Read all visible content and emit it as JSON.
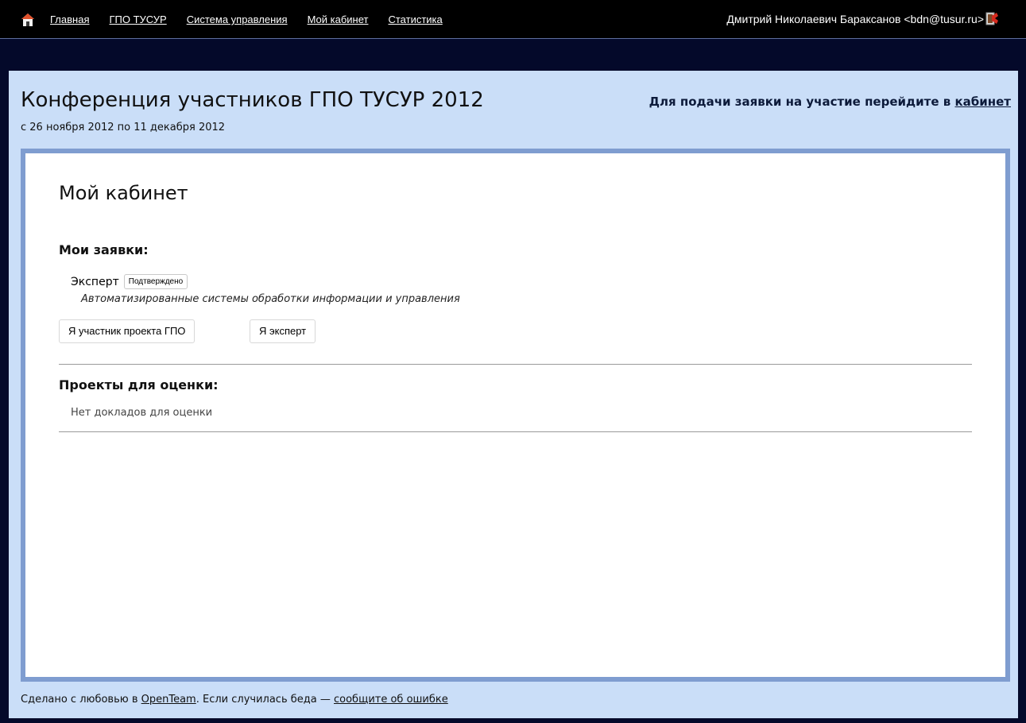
{
  "nav": {
    "links": [
      "Главная",
      "ГПО ТУСУР",
      "Система управления",
      "Мой кабинет",
      "Статистика"
    ],
    "user": "Дмитрий Николаевич Бараксанов <bdn@tusur.ru>"
  },
  "header": {
    "title": "Конференция участников ГПО ТУСУР 2012",
    "dates": "с 26 ноября 2012 по 11 декабря 2012",
    "apply_text": "Для подачи заявки на участие перейдите в",
    "apply_link": "кабинет"
  },
  "cabinet": {
    "title": "Мой кабинет",
    "my_requests_heading": "Мои заявки:",
    "request": {
      "role": "Эксперт",
      "status": "Подтверждено",
      "section": "Автоматизированные системы обработки информации и управления"
    },
    "buttons": {
      "participant": "Я участник проекта ГПО",
      "expert": "Я эксперт"
    },
    "projects_heading": "Проекты для оценки:",
    "projects_empty": "Нет докладов для оценки"
  },
  "footer": {
    "made_text": "Сделано с любовью в",
    "team_link": "OpenTeam",
    "trouble_text": ". Если случилась беда —",
    "report_link": "сообщите об ошибке"
  },
  "colors": {
    "background": "#04092a",
    "topbar": "#000000",
    "panel": "#cadef8",
    "content_border": "#7f9dd0"
  },
  "icons": {
    "home": "home-icon",
    "logout": "logout-icon"
  }
}
